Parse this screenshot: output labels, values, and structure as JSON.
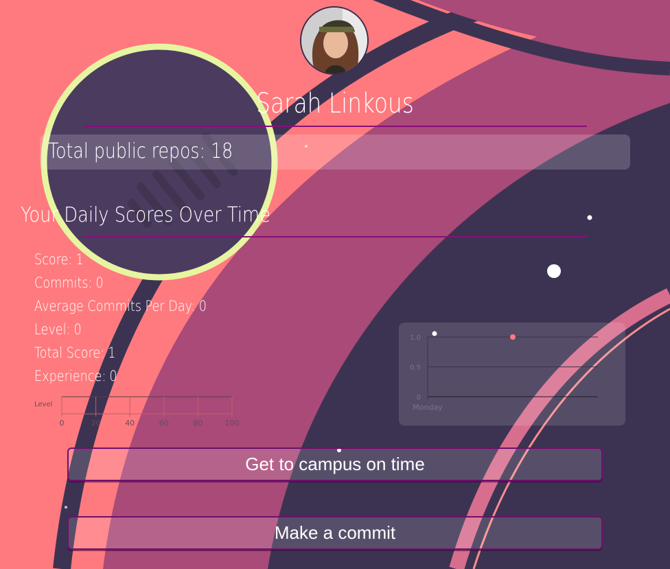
{
  "profile": {
    "name": "Sarah Linkous",
    "avatar_icon": "person-portrait-icon"
  },
  "repos": {
    "label": "Total public repos:",
    "value": "18"
  },
  "scores": {
    "title": "Your Daily Scores Over Time",
    "stats": [
      {
        "label": "Score:",
        "value": "1"
      },
      {
        "label": "Commits:",
        "value": "0"
      },
      {
        "label": "Average Commits Per Day:",
        "value": "0"
      },
      {
        "label": "Level:",
        "value": "0"
      },
      {
        "label": "Total Score:",
        "value": "1"
      },
      {
        "label": "Experience:",
        "value": "0"
      }
    ]
  },
  "actions": {
    "campus_label": "Get to campus on time",
    "commit_label": "Make a commit"
  },
  "colors": {
    "background": "#ff7a7e",
    "dark_swirl": "#3c3352",
    "magenta_swirl": "#a94a78",
    "accent_rule": "#8a0e7a",
    "ring": "#e7f5a0",
    "point": "#ff7a7e"
  },
  "chart_data": [
    {
      "type": "bar",
      "categories": [
        "Level"
      ],
      "values": [
        0
      ],
      "xlim": [
        0,
        100
      ],
      "xticks": [
        "0",
        "20",
        "40",
        "60",
        "80",
        "100"
      ],
      "orientation": "horizontal",
      "grid": true
    },
    {
      "type": "scatter",
      "categories": [
        "Monday"
      ],
      "values": [
        1
      ],
      "ylim": [
        0,
        1
      ],
      "yticks": [
        "0",
        "0.5",
        "1.0"
      ],
      "grid": true
    }
  ]
}
